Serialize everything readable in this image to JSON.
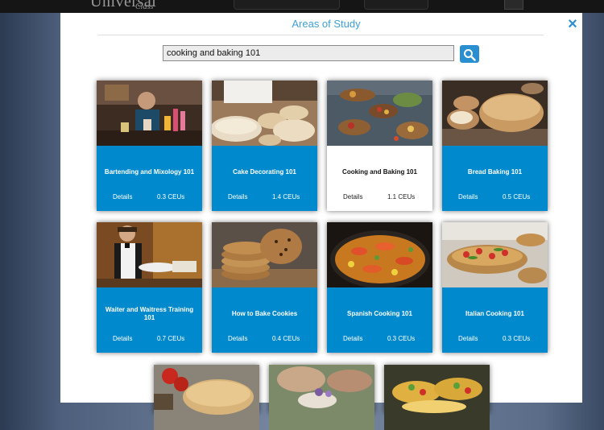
{
  "header": {
    "logo_text": "Universal",
    "logo_sub": "Class"
  },
  "modal": {
    "title": "Areas of Study",
    "close_label": "×",
    "search": {
      "value": "cooking and baking 101"
    }
  },
  "courses": [
    {
      "title": "Bartending and Mixology 101",
      "details": "Details",
      "ceus": "0.3 CEUs"
    },
    {
      "title": "Cake Decorating 101",
      "details": "Details",
      "ceus": "1.4 CEUs"
    },
    {
      "title": "Cooking and Baking 101",
      "details": "Details",
      "ceus": "1.1 CEUs",
      "active": true
    },
    {
      "title": "Bread Baking 101",
      "details": "Details",
      "ceus": "0.5 CEUs"
    },
    {
      "title": "Waiter and Waitress Training 101",
      "details": "Details",
      "ceus": "0.7 CEUs"
    },
    {
      "title": "How to Bake Cookies",
      "details": "Details",
      "ceus": "0.4 CEUs"
    },
    {
      "title": "Spanish Cooking 101",
      "details": "Details",
      "ceus": "0.3 CEUs"
    },
    {
      "title": "Italian Cooking 101",
      "details": "Details",
      "ceus": "0.3 CEUs"
    }
  ],
  "colors": {
    "accent": "#0089cc",
    "title_blue": "#3d9fd6"
  }
}
